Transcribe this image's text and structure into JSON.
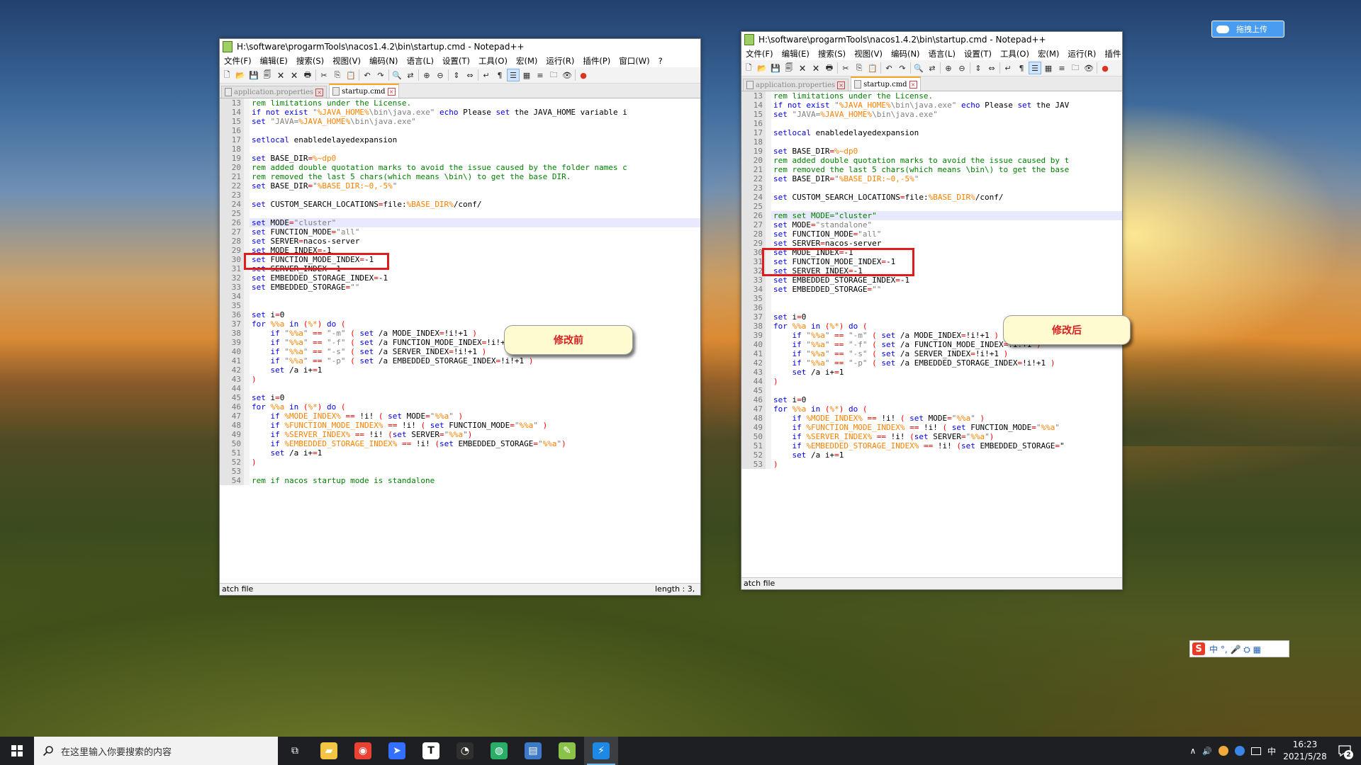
{
  "desktop": {
    "upload_label": "拖拽上传",
    "ime_label": "中 °, 🎤 ⛭ ▦",
    "ime_logo": "S"
  },
  "windows": [
    {
      "title": "H:\\software\\progarmTools\\nacos1.4.2\\bin\\startup.cmd - Notepad++",
      "menus": [
        "文件(F)",
        "编辑(E)",
        "搜索(S)",
        "视图(V)",
        "编码(N)",
        "语言(L)",
        "设置(T)",
        "工具(O)",
        "宏(M)",
        "运行(R)",
        "插件(P)",
        "窗口(W)",
        "?"
      ],
      "tabs": [
        {
          "label": "application.properties",
          "active": false
        },
        {
          "label": "startup.cmd",
          "active": true
        }
      ],
      "status_left": "atch file",
      "status_right": "length : 3,",
      "callout": "修改前"
    },
    {
      "title": "H:\\software\\progarmTools\\nacos1.4.2\\bin\\startup.cmd - Notepad++",
      "menus": [
        "文件(F)",
        "编辑(E)",
        "搜索(S)",
        "视图(V)",
        "编码(N)",
        "语言(L)",
        "设置(T)",
        "工具(O)",
        "宏(M)",
        "运行(R)",
        "插件"
      ],
      "tabs": [
        {
          "label": "application.properties",
          "active": false
        },
        {
          "label": "startup.cmd",
          "active": true
        }
      ],
      "status_left": "atch file",
      "status_right": "",
      "callout": "修改后"
    }
  ],
  "code_before": [
    {
      "n": "13",
      "t": "rem limitations under the License."
    },
    {
      "n": "14",
      "t": "if not exist \"%JAVA_HOME%\\bin\\java.exe\" echo Please set the JAVA_HOME variable i"
    },
    {
      "n": "15",
      "t": "set \"JAVA=%JAVA_HOME%\\bin\\java.exe\""
    },
    {
      "n": "16",
      "t": ""
    },
    {
      "n": "17",
      "t": "setlocal enabledelayedexpansion"
    },
    {
      "n": "18",
      "t": ""
    },
    {
      "n": "19",
      "t": "set BASE_DIR=%~dp0"
    },
    {
      "n": "20",
      "t": "rem added double quotation marks to avoid the issue caused by the folder names c"
    },
    {
      "n": "21",
      "t": "rem removed the last 5 chars(which means \\bin\\) to get the base DIR."
    },
    {
      "n": "22",
      "t": "set BASE_DIR=\"%BASE_DIR:~0,-5%\""
    },
    {
      "n": "23",
      "t": ""
    },
    {
      "n": "24",
      "t": "set CUSTOM_SEARCH_LOCATIONS=file:%BASE_DIR%/conf/"
    },
    {
      "n": "25",
      "t": ""
    },
    {
      "n": "26",
      "t": "set MODE=\"cluster\""
    },
    {
      "n": "27",
      "t": "set FUNCTION_MODE=\"all\""
    },
    {
      "n": "28",
      "t": "set SERVER=nacos-server"
    },
    {
      "n": "29",
      "t": "set MODE_INDEX=-1"
    },
    {
      "n": "30",
      "t": "set FUNCTION_MODE_INDEX=-1"
    },
    {
      "n": "31",
      "t": "set SERVER_INDEX=-1"
    },
    {
      "n": "32",
      "t": "set EMBEDDED_STORAGE_INDEX=-1"
    },
    {
      "n": "33",
      "t": "set EMBEDDED_STORAGE=\"\""
    },
    {
      "n": "34",
      "t": ""
    },
    {
      "n": "35",
      "t": ""
    },
    {
      "n": "36",
      "t": "set i=0"
    },
    {
      "n": "37",
      "t": "for %%a in (%*) do ("
    },
    {
      "n": "38",
      "t": "    if \"%%a\" == \"-m\" ( set /a MODE_INDEX=!i!+1 )"
    },
    {
      "n": "39",
      "t": "    if \"%%a\" == \"-f\" ( set /a FUNCTION_MODE_INDEX=!i!+1 )"
    },
    {
      "n": "40",
      "t": "    if \"%%a\" == \"-s\" ( set /a SERVER_INDEX=!i!+1 )"
    },
    {
      "n": "41",
      "t": "    if \"%%a\" == \"-p\" ( set /a EMBEDDED_STORAGE_INDEX=!i!+1 )"
    },
    {
      "n": "42",
      "t": "    set /a i+=1"
    },
    {
      "n": "43",
      "t": ")"
    },
    {
      "n": "44",
      "t": ""
    },
    {
      "n": "45",
      "t": "set i=0"
    },
    {
      "n": "46",
      "t": "for %%a in (%*) do ("
    },
    {
      "n": "47",
      "t": "    if %MODE_INDEX% == !i! ( set MODE=\"%%a\" )"
    },
    {
      "n": "48",
      "t": "    if %FUNCTION_MODE_INDEX% == !i! ( set FUNCTION_MODE=\"%%a\" )"
    },
    {
      "n": "49",
      "t": "    if %SERVER_INDEX% == !i! (set SERVER=\"%%a\")"
    },
    {
      "n": "50",
      "t": "    if %EMBEDDED_STORAGE_INDEX% == !i! (set EMBEDDED_STORAGE=\"%%a\")"
    },
    {
      "n": "51",
      "t": "    set /a i+=1"
    },
    {
      "n": "52",
      "t": ")"
    },
    {
      "n": "53",
      "t": ""
    },
    {
      "n": "54",
      "t": "rem if nacos startup mode is standalone"
    }
  ],
  "code_after": [
    {
      "n": "13",
      "t": "rem limitations under the License."
    },
    {
      "n": "14",
      "t": "if not exist \"%JAVA_HOME%\\bin\\java.exe\" echo Please set the JAV"
    },
    {
      "n": "15",
      "t": "set \"JAVA=%JAVA_HOME%\\bin\\java.exe\""
    },
    {
      "n": "16",
      "t": ""
    },
    {
      "n": "17",
      "t": "setlocal enabledelayedexpansion"
    },
    {
      "n": "18",
      "t": ""
    },
    {
      "n": "19",
      "t": "set BASE_DIR=%~dp0"
    },
    {
      "n": "20",
      "t": "rem added double quotation marks to avoid the issue caused by t"
    },
    {
      "n": "21",
      "t": "rem removed the last 5 chars(which means \\bin\\) to get the base"
    },
    {
      "n": "22",
      "t": "set BASE_DIR=\"%BASE_DIR:~0,-5%\""
    },
    {
      "n": "23",
      "t": ""
    },
    {
      "n": "24",
      "t": "set CUSTOM_SEARCH_LOCATIONS=file:%BASE_DIR%/conf/"
    },
    {
      "n": "25",
      "t": ""
    },
    {
      "n": "26",
      "t": "rem set MODE=\"cluster\""
    },
    {
      "n": "27",
      "t": "set MODE=\"standalone\""
    },
    {
      "n": "28",
      "t": "set FUNCTION_MODE=\"all\""
    },
    {
      "n": "29",
      "t": "set SERVER=nacos-server"
    },
    {
      "n": "30",
      "t": "set MODE_INDEX=-1"
    },
    {
      "n": "31",
      "t": "set FUNCTION_MODE_INDEX=-1"
    },
    {
      "n": "32",
      "t": "set SERVER_INDEX=-1"
    },
    {
      "n": "33",
      "t": "set EMBEDDED_STORAGE_INDEX=-1"
    },
    {
      "n": "34",
      "t": "set EMBEDDED_STORAGE=\"\""
    },
    {
      "n": "35",
      "t": ""
    },
    {
      "n": "36",
      "t": ""
    },
    {
      "n": "37",
      "t": "set i=0"
    },
    {
      "n": "38",
      "t": "for %%a in (%*) do ("
    },
    {
      "n": "39",
      "t": "    if \"%%a\" == \"-m\" ( set /a MODE_INDEX=!i!+1 )"
    },
    {
      "n": "40",
      "t": "    if \"%%a\" == \"-f\" ( set /a FUNCTION_MODE_INDEX=!i!+1 )"
    },
    {
      "n": "41",
      "t": "    if \"%%a\" == \"-s\" ( set /a SERVER_INDEX=!i!+1 )"
    },
    {
      "n": "42",
      "t": "    if \"%%a\" == \"-p\" ( set /a EMBEDDED_STORAGE_INDEX=!i!+1 )"
    },
    {
      "n": "43",
      "t": "    set /a i+=1"
    },
    {
      "n": "44",
      "t": ")"
    },
    {
      "n": "45",
      "t": ""
    },
    {
      "n": "46",
      "t": "set i=0"
    },
    {
      "n": "47",
      "t": "for %%a in (%*) do ("
    },
    {
      "n": "48",
      "t": "    if %MODE_INDEX% == !i! ( set MODE=\"%%a\" )"
    },
    {
      "n": "49",
      "t": "    if %FUNCTION_MODE_INDEX% == !i! ( set FUNCTION_MODE=\"%%a\""
    },
    {
      "n": "50",
      "t": "    if %SERVER_INDEX% == !i! (set SERVER=\"%%a\")"
    },
    {
      "n": "51",
      "t": "    if %EMBEDDED_STORAGE_INDEX% == !i! (set EMBEDDED_STORAGE=\""
    },
    {
      "n": "52",
      "t": "    set /a i+=1"
    },
    {
      "n": "53",
      "t": ")"
    }
  ],
  "taskbar": {
    "search_placeholder": "在这里输入你要搜索的内容",
    "apps": [
      {
        "name": "task-view",
        "glyph": "⧉",
        "color": "",
        "active": false
      },
      {
        "name": "file-explorer",
        "glyph": "▰",
        "color": "#f4c542",
        "active": false
      },
      {
        "name": "chrome",
        "glyph": "◉",
        "color": "#e94235",
        "active": false
      },
      {
        "name": "feishu",
        "glyph": "➤",
        "color": "#3370ff",
        "active": false
      },
      {
        "name": "typora",
        "glyph": "T",
        "color": "#ffffff",
        "active": false
      },
      {
        "name": "color-app",
        "glyph": "◔",
        "color": "#2f2f2f",
        "active": false
      },
      {
        "name": "wechat",
        "glyph": "◍",
        "color": "#2aae67",
        "active": false
      },
      {
        "name": "winrar",
        "glyph": "▤",
        "color": "#3d79c8",
        "active": false
      },
      {
        "name": "notepadpp",
        "glyph": "✎",
        "color": "#8bc34a",
        "active": false
      },
      {
        "name": "active-app",
        "glyph": "⚡",
        "color": "#1e88e5",
        "active": true
      }
    ],
    "tray_chevron": "∧",
    "tray_sound": "🔊",
    "tray_lang": "中",
    "time": "16:23",
    "date": "2021/5/28",
    "notification_count": "2"
  }
}
